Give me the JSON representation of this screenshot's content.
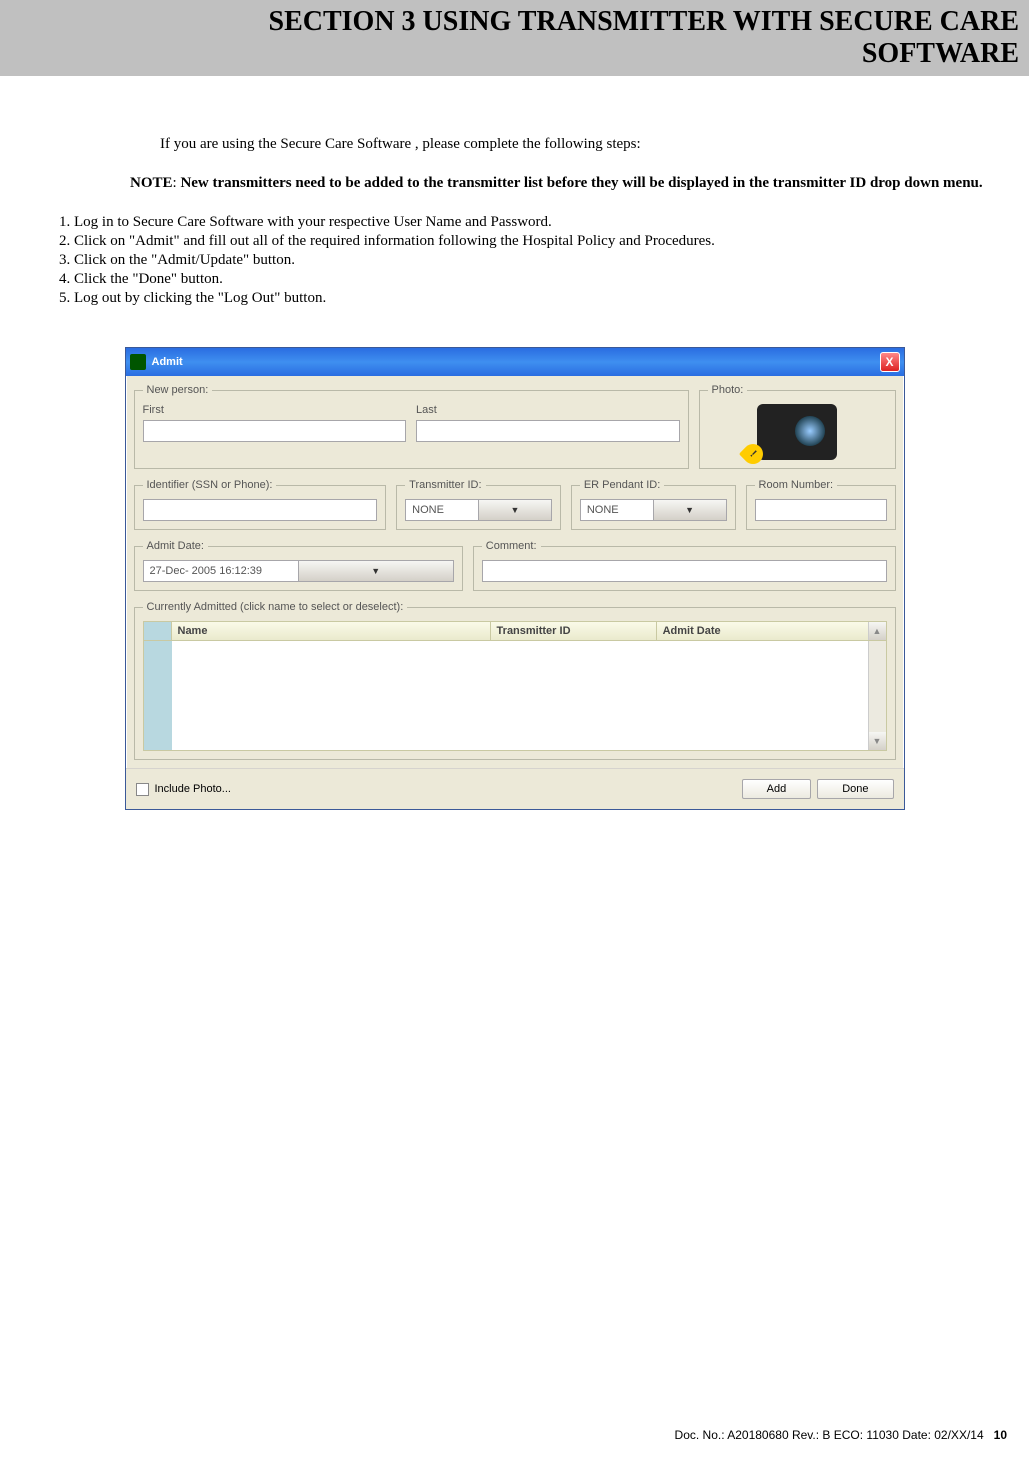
{
  "section": {
    "title_line1": "SECTION 3   USING TRANSMITTER WITH SECURE CARE",
    "title_line2": "SOFTWARE"
  },
  "intro": "If you are using the Secure Care Software , please complete the following steps:",
  "note": {
    "label": "NOTE",
    "text": "New transmitters need to be added to the transmitter list before they will be displayed in the transmitter ID drop down menu."
  },
  "steps": [
    "Log in to Secure Care Software with your respective User Name and Password.",
    "Click on \"Admit\" and fill out all of the required information following the Hospital Policy and Procedures.",
    "Click on the \"Admit/Update\" button.",
    "Click the \"Done\" button.",
    "Log out by clicking the \"Log Out\" button."
  ],
  "admit": {
    "title": "Admit",
    "new_person_legend": "New person:",
    "first_label": "First",
    "last_label": "Last",
    "first_value": "",
    "last_value": "",
    "photo_legend": "Photo:",
    "identifier_legend": "Identifier (SSN or Phone):",
    "identifier_value": "",
    "transmitter_legend": "Transmitter ID:",
    "transmitter_value": "NONE",
    "er_legend": "ER Pendant ID:",
    "er_value": "NONE",
    "room_legend": "Room Number:",
    "room_value": "",
    "admit_date_legend": "Admit Date:",
    "admit_date_value": "27-Dec- 2005  16:12:39",
    "comment_legend": "Comment:",
    "comment_value": "",
    "currently_legend": "Currently Admitted (click name to select or deselect):",
    "col_name": "Name",
    "col_tid": "Transmitter ID",
    "col_date": "Admit Date",
    "include_photo_label": "Include Photo...",
    "add_btn": "Add",
    "done_btn": "Done"
  },
  "footer": {
    "doc": "Doc. No.:  A20180680   Rev.: B   ECO: 11030   Date: 02/XX/14",
    "page": "10"
  }
}
